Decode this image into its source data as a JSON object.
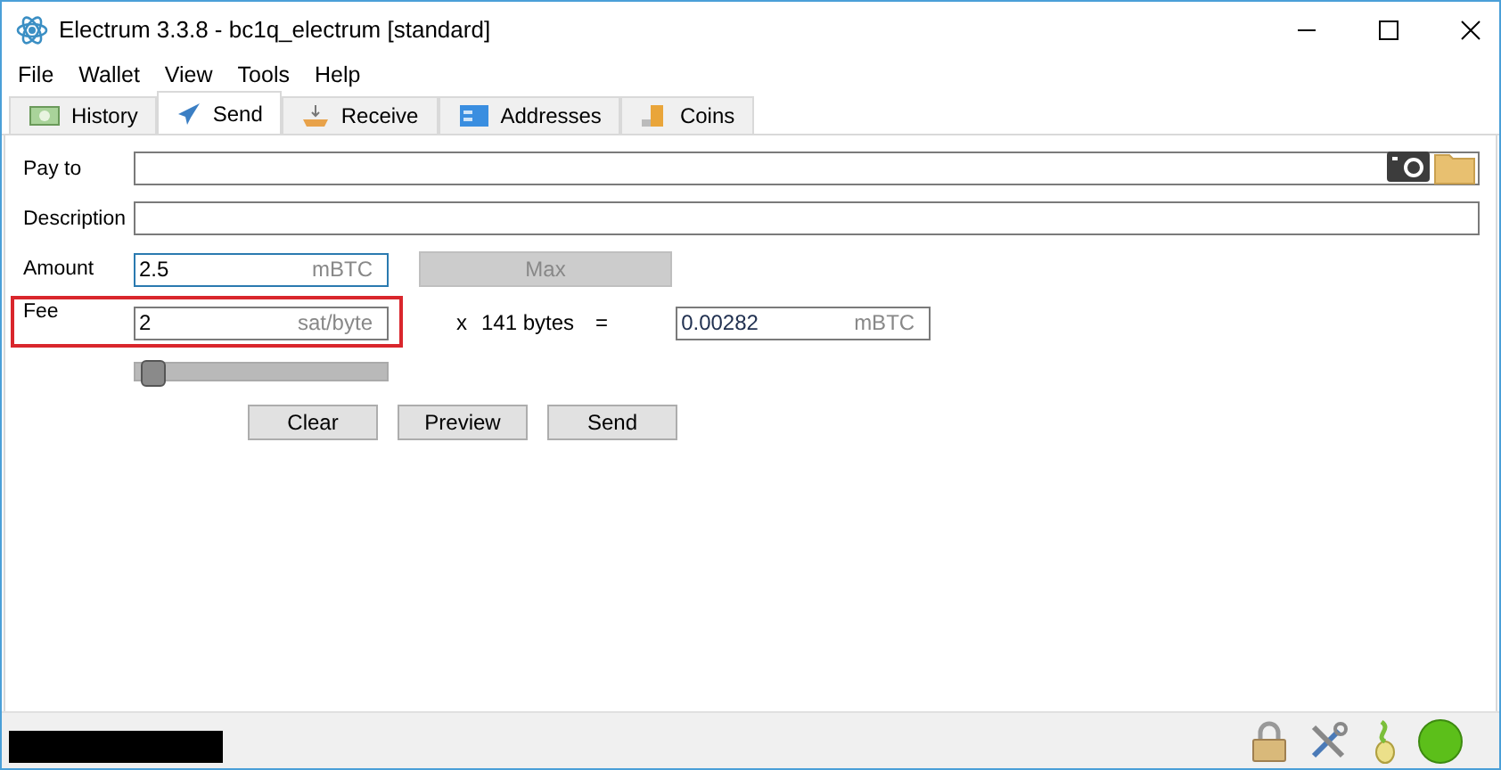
{
  "window": {
    "title": "Electrum 3.3.8  -  bc1q_electrum  [standard]"
  },
  "menu": [
    "File",
    "Wallet",
    "View",
    "Tools",
    "Help"
  ],
  "tabs": [
    {
      "label": "History",
      "selected": false
    },
    {
      "label": "Send",
      "selected": true
    },
    {
      "label": "Receive",
      "selected": false
    },
    {
      "label": "Addresses",
      "selected": false
    },
    {
      "label": "Coins",
      "selected": false
    }
  ],
  "send": {
    "pay_to": {
      "label": "Pay to"
    },
    "description": {
      "label": "Description"
    },
    "amount": {
      "label": "Amount",
      "value": "2.5",
      "unit": "mBTC",
      "focused": true
    },
    "max_button": {
      "label": "Max",
      "disabled": true
    },
    "fee": {
      "label": "Fee",
      "highlighted": true,
      "value": "2",
      "unit": "sat/byte",
      "times": "x",
      "size": "141 bytes",
      "equals": "=",
      "total": "0.00282",
      "total_unit": "mBTC"
    },
    "fee_slider": {
      "level": 0.02
    },
    "buttons": [
      "Clear",
      "Preview",
      "Send"
    ]
  },
  "status_bar": {
    "redacted": true
  }
}
